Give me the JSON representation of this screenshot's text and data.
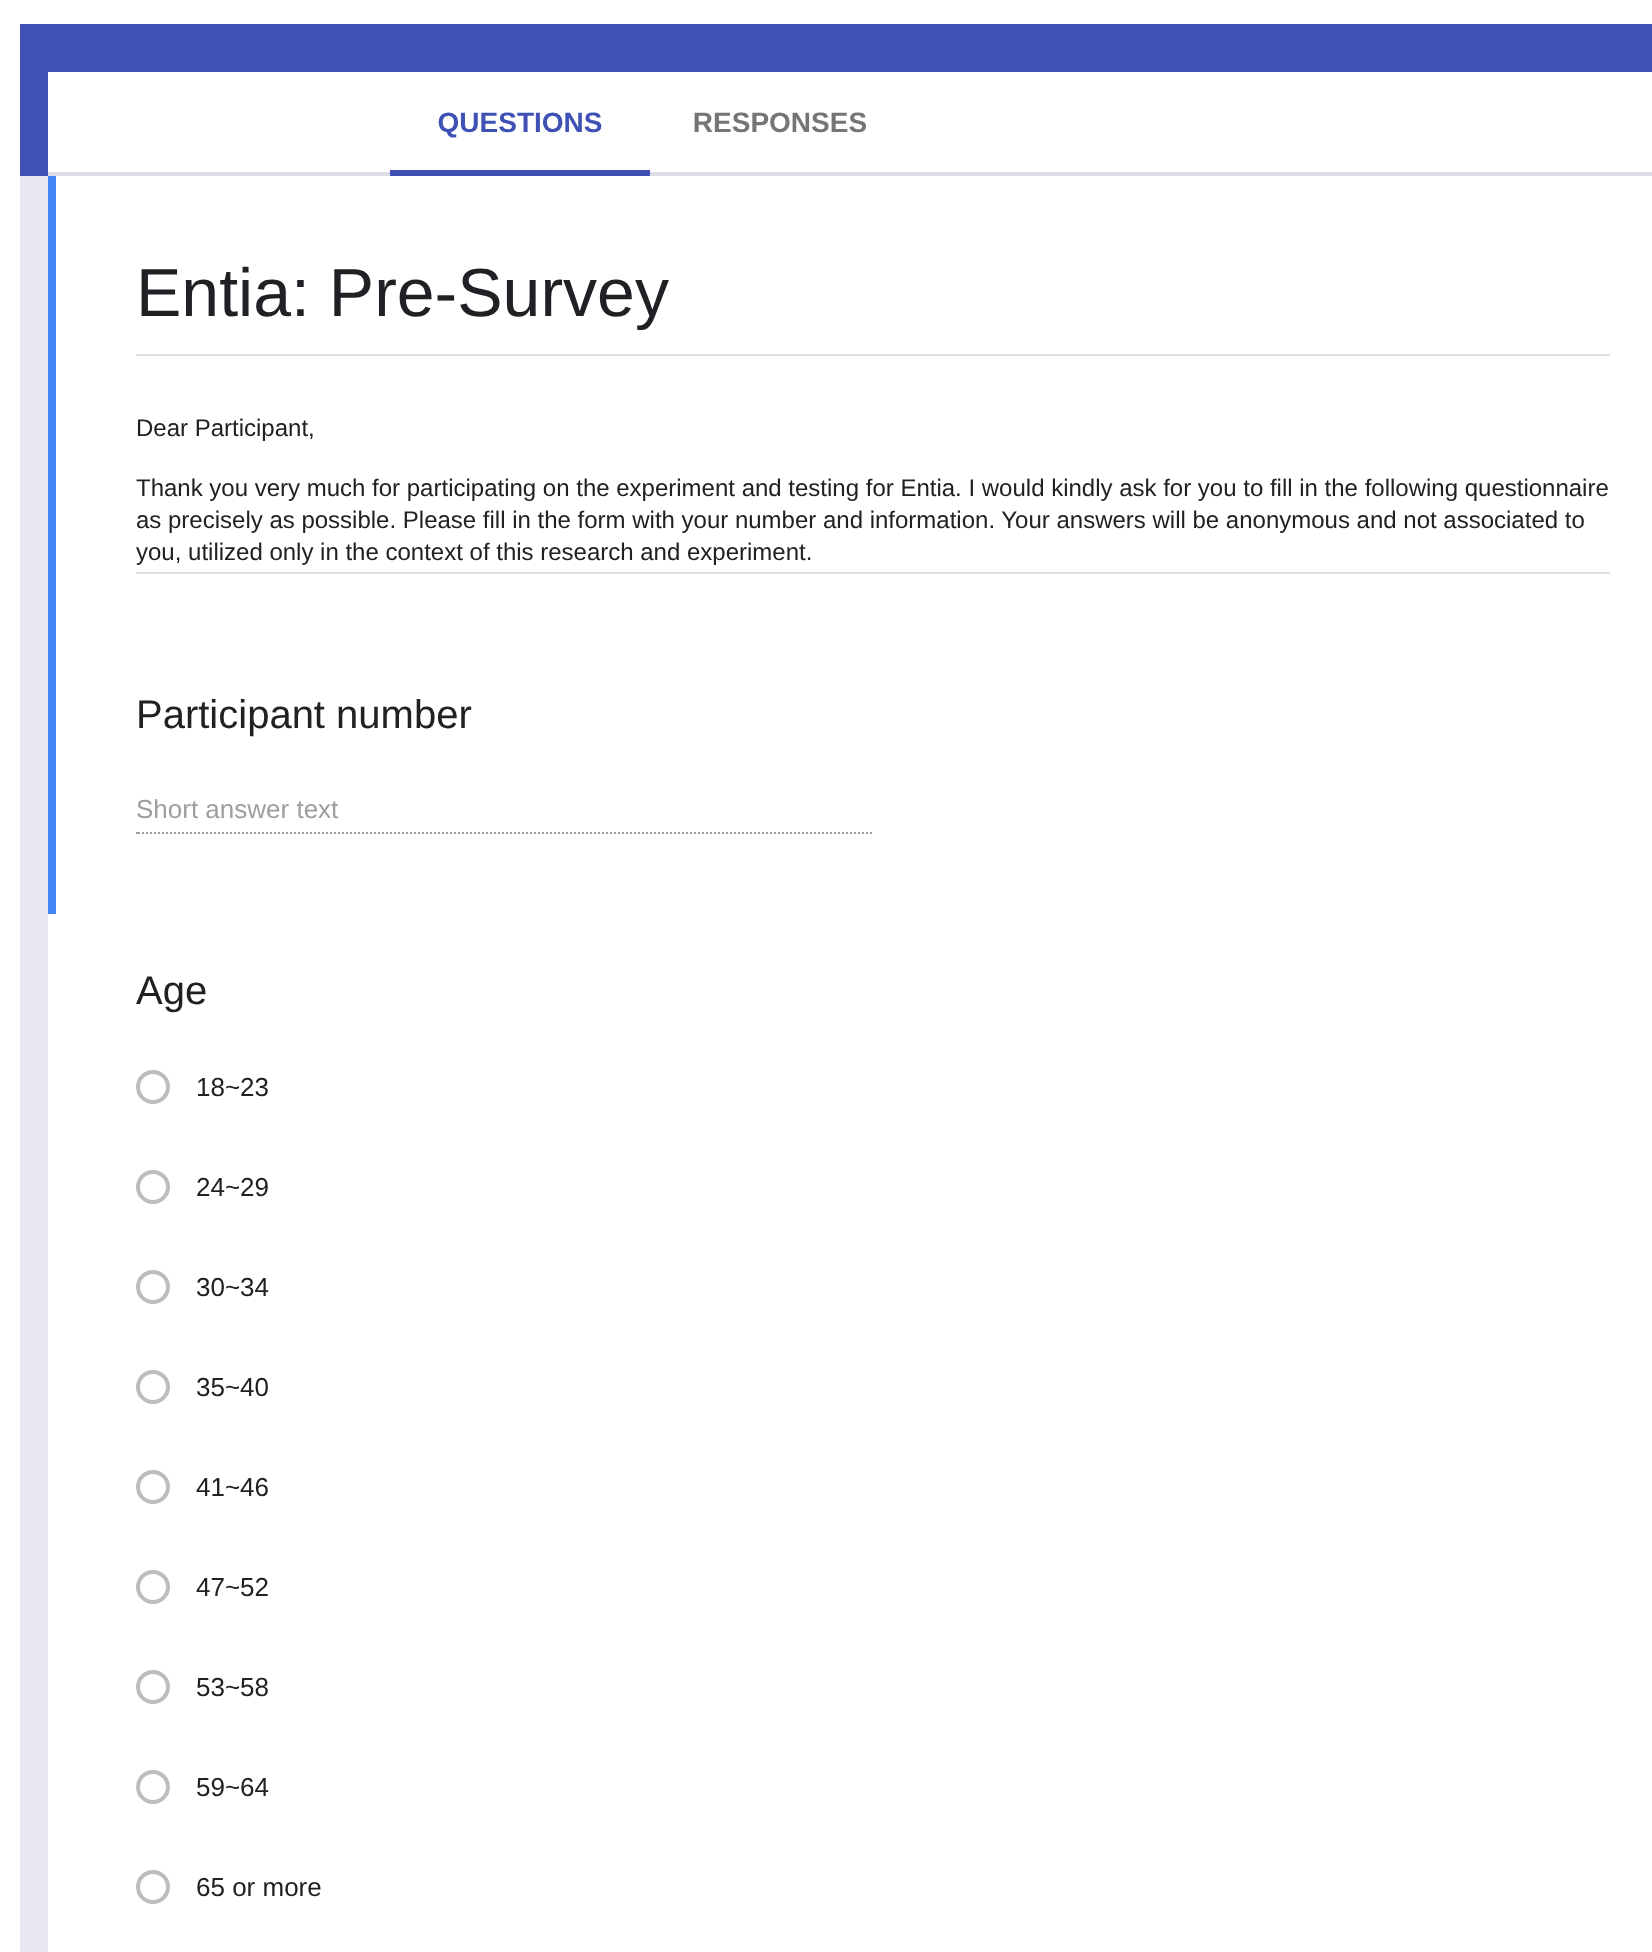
{
  "tabs": [
    {
      "label": "QUESTIONS",
      "selected": true
    },
    {
      "label": "RESPONSES",
      "selected": false
    }
  ],
  "form": {
    "title": "Entia: Pre-Survey",
    "description": [
      "Dear Participant,",
      "Thank you very much for participating on the experiment and testing for Entia. I would kindly ask for you to fill in the following questionnaire as precisely as possible. Please fill in the form with your number and information. Your answers will be anonymous and not associated to you, utilized only in the context of this research and experiment."
    ]
  },
  "questions": [
    {
      "kind": "short",
      "title": "Participant number",
      "placeholder": "Short answer text",
      "focused": true
    },
    {
      "kind": "choice",
      "title": "Age",
      "focused": false,
      "options": [
        {
          "label": "18~23",
          "selected": false
        },
        {
          "label": "24~29",
          "selected": false
        },
        {
          "label": "30~34",
          "selected": false
        },
        {
          "label": "35~40",
          "selected": false
        },
        {
          "label": "41~46",
          "selected": false
        },
        {
          "label": "47~52",
          "selected": false
        },
        {
          "label": "53~58",
          "selected": false
        },
        {
          "label": "59~64",
          "selected": false
        },
        {
          "label": "65 or more",
          "selected": false
        }
      ]
    }
  ]
}
